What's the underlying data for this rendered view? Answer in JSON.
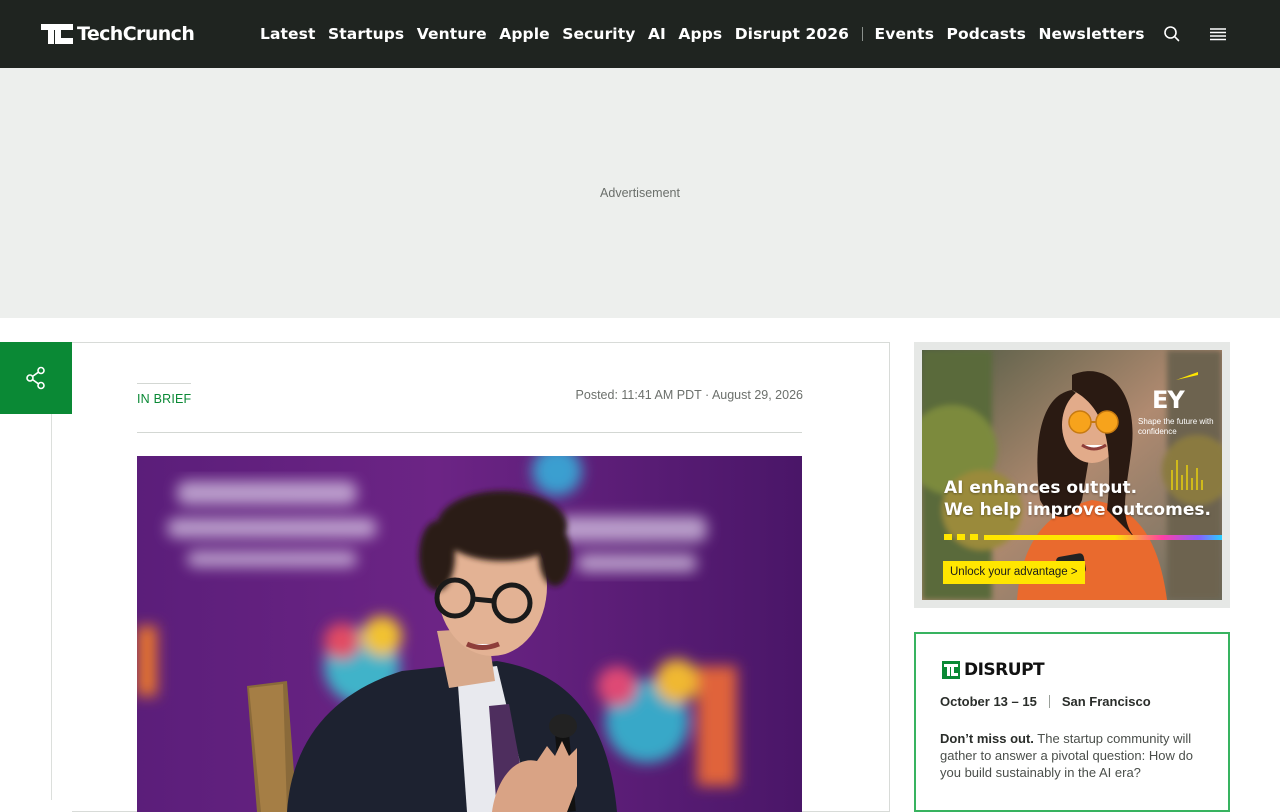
{
  "header": {
    "logo_text": "TechCrunch",
    "nav": [
      "Latest",
      "Startups",
      "Venture",
      "Apple",
      "Security",
      "AI",
      "Apps",
      "Disrupt 2026"
    ],
    "nav_secondary": [
      "Events",
      "Podcasts",
      "Newsletters"
    ],
    "icons": [
      "search-icon",
      "hamburger-menu-icon"
    ],
    "background_color": "#1f2420"
  },
  "ad_band": {
    "label": "Advertisement"
  },
  "share": {
    "icon": "share-icon",
    "color": "#0a8935"
  },
  "article": {
    "kicker": "IN BRIEF",
    "posted": "Posted: 11:41 AM PDT · August 29, 2026",
    "accent_color": "#0a8935"
  },
  "sidebar_ad": {
    "brand": "EY",
    "tagline": "Shape the future with confidence",
    "headline_line1": "AI enhances output.",
    "headline_line2": "We help improve outcomes.",
    "cta": "Unlock your advantage >",
    "accent_color": "#ffe600"
  },
  "promo": {
    "brand": "DISRUPT",
    "dates": "October 13 – 15",
    "location": "San Francisco",
    "lead": "Don’t miss out.",
    "body": " The startup community will gather to answer a pivotal question: How do you build sustainably in the AI era?",
    "border_color": "#38b360"
  }
}
